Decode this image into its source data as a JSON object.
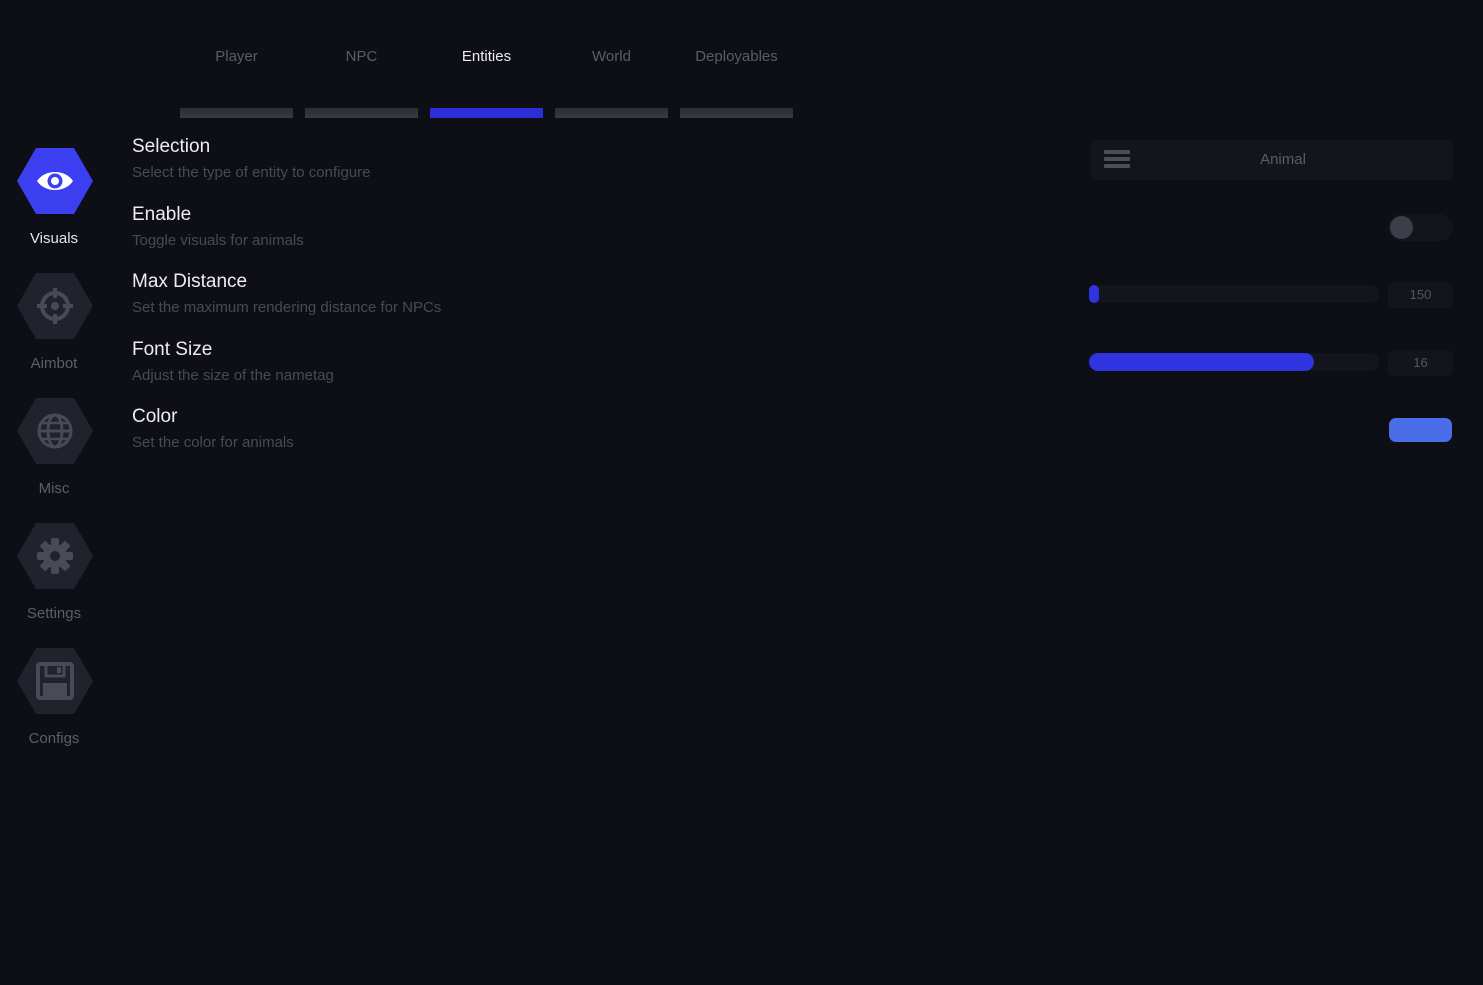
{
  "sidebar": {
    "items": [
      {
        "label": "Visuals",
        "icon": "eye-icon",
        "active": true
      },
      {
        "label": "Aimbot",
        "icon": "crosshair-icon",
        "active": false
      },
      {
        "label": "Misc",
        "icon": "globe-icon",
        "active": false
      },
      {
        "label": "Settings",
        "icon": "gear-icon",
        "active": false
      },
      {
        "label": "Configs",
        "icon": "floppy-disk-icon",
        "active": false
      }
    ]
  },
  "tabs": [
    {
      "label": "Player",
      "active": false
    },
    {
      "label": "NPC",
      "active": false
    },
    {
      "label": "Entities",
      "active": true
    },
    {
      "label": "World",
      "active": false
    },
    {
      "label": "Deployables",
      "active": false
    }
  ],
  "settings": {
    "selection": {
      "title": "Selection",
      "desc": "Select the type of entity to configure",
      "value": "Animal"
    },
    "enable": {
      "title": "Enable",
      "desc": "Toggle visuals for animals",
      "on": false
    },
    "max_distance": {
      "title": "Max Distance",
      "desc": "Set the maximum rendering distance for NPCs",
      "value": "150",
      "fraction": 0.03
    },
    "font_size": {
      "title": "Font Size",
      "desc": "Adjust the size of the nametag",
      "value": "16",
      "fraction": 0.775
    },
    "color": {
      "title": "Color",
      "desc": "Set the color for animals",
      "hex": "#4a6ee8"
    }
  },
  "colors": {
    "accent": "#3c3ff0",
    "background": "#0e0e16",
    "panel": "#14141c"
  }
}
